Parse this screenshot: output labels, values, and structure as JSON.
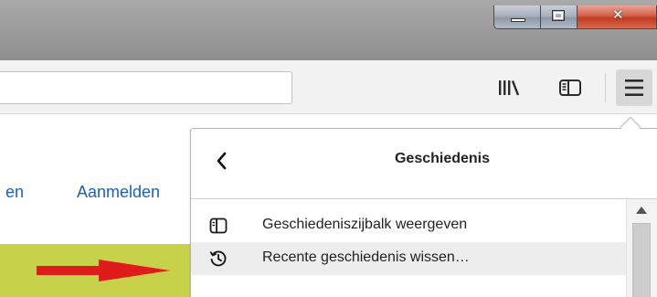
{
  "window": {
    "controls": [
      "minimize",
      "maximize",
      "close"
    ],
    "close_color": "#c8402a"
  },
  "toolbar": {
    "address_bar_value": "",
    "icons": [
      "library-icon",
      "sidebar-icon",
      "hamburger-menu-icon"
    ]
  },
  "page": {
    "links": [
      "en",
      "Aanmelden"
    ],
    "link_color": "#1a61b7",
    "band_color": "#c8d14a",
    "arrow_color": "#e01b1b"
  },
  "history_panel": {
    "title": "Geschiedenis",
    "items": [
      {
        "label": "Geschiedeniszijbalk weergeven",
        "icon": "sidebar-icon"
      },
      {
        "label": "Recente geschiedenis wissen…",
        "icon": "history-clock-icon"
      }
    ]
  }
}
